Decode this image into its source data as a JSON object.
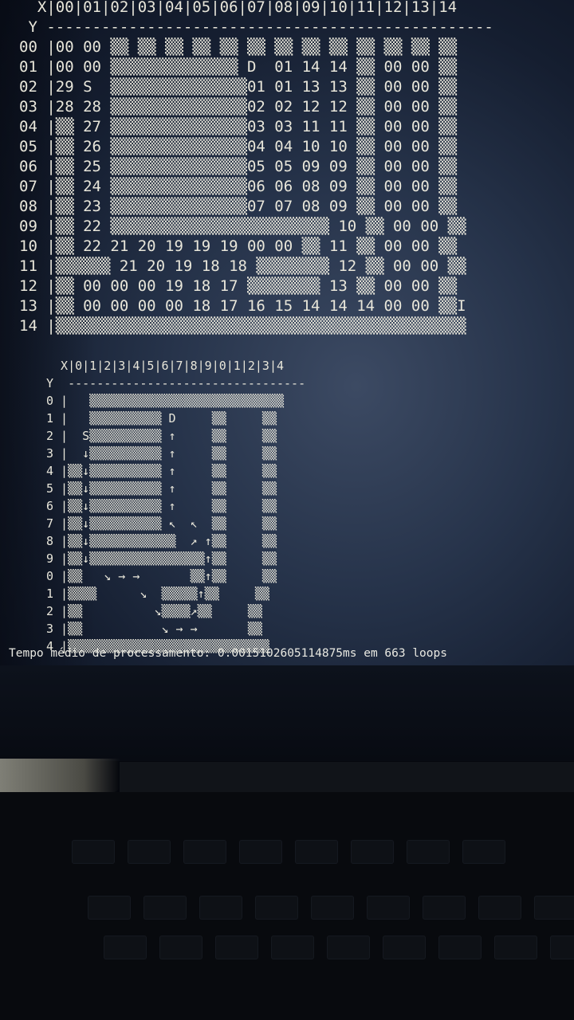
{
  "grid1": [
    "  X|00|01|02|03|04|05|06|07|08|09|10|11|12|13|14",
    " Y -------------------------------------------------",
    "00 |00 00 ▒▒ ▒▒ ▒▒ ▒▒ ▒▒ ▒▒ ▒▒ ▒▒ ▒▒ ▒▒ ▒▒ ▒▒ ▒▒",
    "01 |00 00 ▒▒▒▒▒▒▒▒▒▒▒▒▒▒ D  01 14 14 ▒▒ 00 00 ▒▒",
    "02 |29 S  ▒▒▒▒▒▒▒▒▒▒▒▒▒▒▒01 01 13 13 ▒▒ 00 00 ▒▒",
    "03 |28 28 ▒▒▒▒▒▒▒▒▒▒▒▒▒▒▒02 02 12 12 ▒▒ 00 00 ▒▒",
    "04 |▒▒ 27 ▒▒▒▒▒▒▒▒▒▒▒▒▒▒▒03 03 11 11 ▒▒ 00 00 ▒▒",
    "05 |▒▒ 26 ▒▒▒▒▒▒▒▒▒▒▒▒▒▒▒04 04 10 10 ▒▒ 00 00 ▒▒",
    "06 |▒▒ 25 ▒▒▒▒▒▒▒▒▒▒▒▒▒▒▒05 05 09 09 ▒▒ 00 00 ▒▒",
    "07 |▒▒ 24 ▒▒▒▒▒▒▒▒▒▒▒▒▒▒▒06 06 08 09 ▒▒ 00 00 ▒▒",
    "08 |▒▒ 23 ▒▒▒▒▒▒▒▒▒▒▒▒▒▒▒07 07 08 09 ▒▒ 00 00 ▒▒",
    "09 |▒▒ 22 ▒▒▒▒▒▒▒▒▒▒▒▒▒▒▒▒▒▒▒▒▒▒▒▒ 10 ▒▒ 00 00 ▒▒",
    "10 |▒▒ 22 21 20 19 19 19 00 00 ▒▒ 11 ▒▒ 00 00 ▒▒",
    "11 |▒▒▒▒▒▒ 21 20 19 18 18 ▒▒▒▒▒▒▒▒ 12 ▒▒ 00 00 ▒▒",
    "12 |▒▒ 00 00 00 19 18 17 ▒▒▒▒▒▒▒▒ 13 ▒▒ 00 00 ▒▒",
    "13 |▒▒ 00 00 00 00 18 17 16 15 14 14 14 00 00 ▒▒I",
    "14 |▒▒▒▒▒▒▒▒▒▒▒▒▒▒▒▒▒▒▒▒▒▒▒▒▒▒▒▒▒▒▒▒▒▒▒▒▒▒▒▒▒▒▒▒▒"
  ],
  "grid2": [
    "  X|0|1|2|3|4|5|6|7|8|9|0|1|2|3|4",
    "Y  ---------------------------------",
    "0 |   ▒▒▒▒▒▒▒▒▒▒▒▒▒▒▒▒▒▒▒▒▒▒▒▒▒▒▒",
    "1 |   ▒▒▒▒▒▒▒▒▒▒ D     ▒▒     ▒▒",
    "2 |  S▒▒▒▒▒▒▒▒▒▒ ↑     ▒▒     ▒▒",
    "3 |  ↓▒▒▒▒▒▒▒▒▒▒ ↑     ▒▒     ▒▒",
    "4 |▒▒↓▒▒▒▒▒▒▒▒▒▒ ↑     ▒▒     ▒▒",
    "5 |▒▒↓▒▒▒▒▒▒▒▒▒▒ ↑     ▒▒     ▒▒",
    "6 |▒▒↓▒▒▒▒▒▒▒▒▒▒ ↑     ▒▒     ▒▒",
    "7 |▒▒↓▒▒▒▒▒▒▒▒▒▒ ↖  ↖  ▒▒     ▒▒",
    "8 |▒▒↓▒▒▒▒▒▒▒▒▒▒▒▒  ↗ ↑▒▒     ▒▒",
    "9 |▒▒↓▒▒▒▒▒▒▒▒▒▒▒▒▒▒▒▒↑▒▒     ▒▒",
    "0 |▒▒   ↘ → →       ▒▒↑▒▒     ▒▒",
    "1 |▒▒▒▒      ↘  ▒▒▒▒▒↑▒▒     ▒▒",
    "2 |▒▒          ↘▒▒▒▒↗▒▒     ▒▒",
    "3 |▒▒           ↘ → →       ▒▒",
    "4 |▒▒▒▒▒▒▒▒▒▒▒▒▒▒▒▒▒▒▒▒▒▒▒▒▒▒▒▒"
  ],
  "footer": "Tempo médio de processamento: 0.0015102605114875ms em 663 loops"
}
